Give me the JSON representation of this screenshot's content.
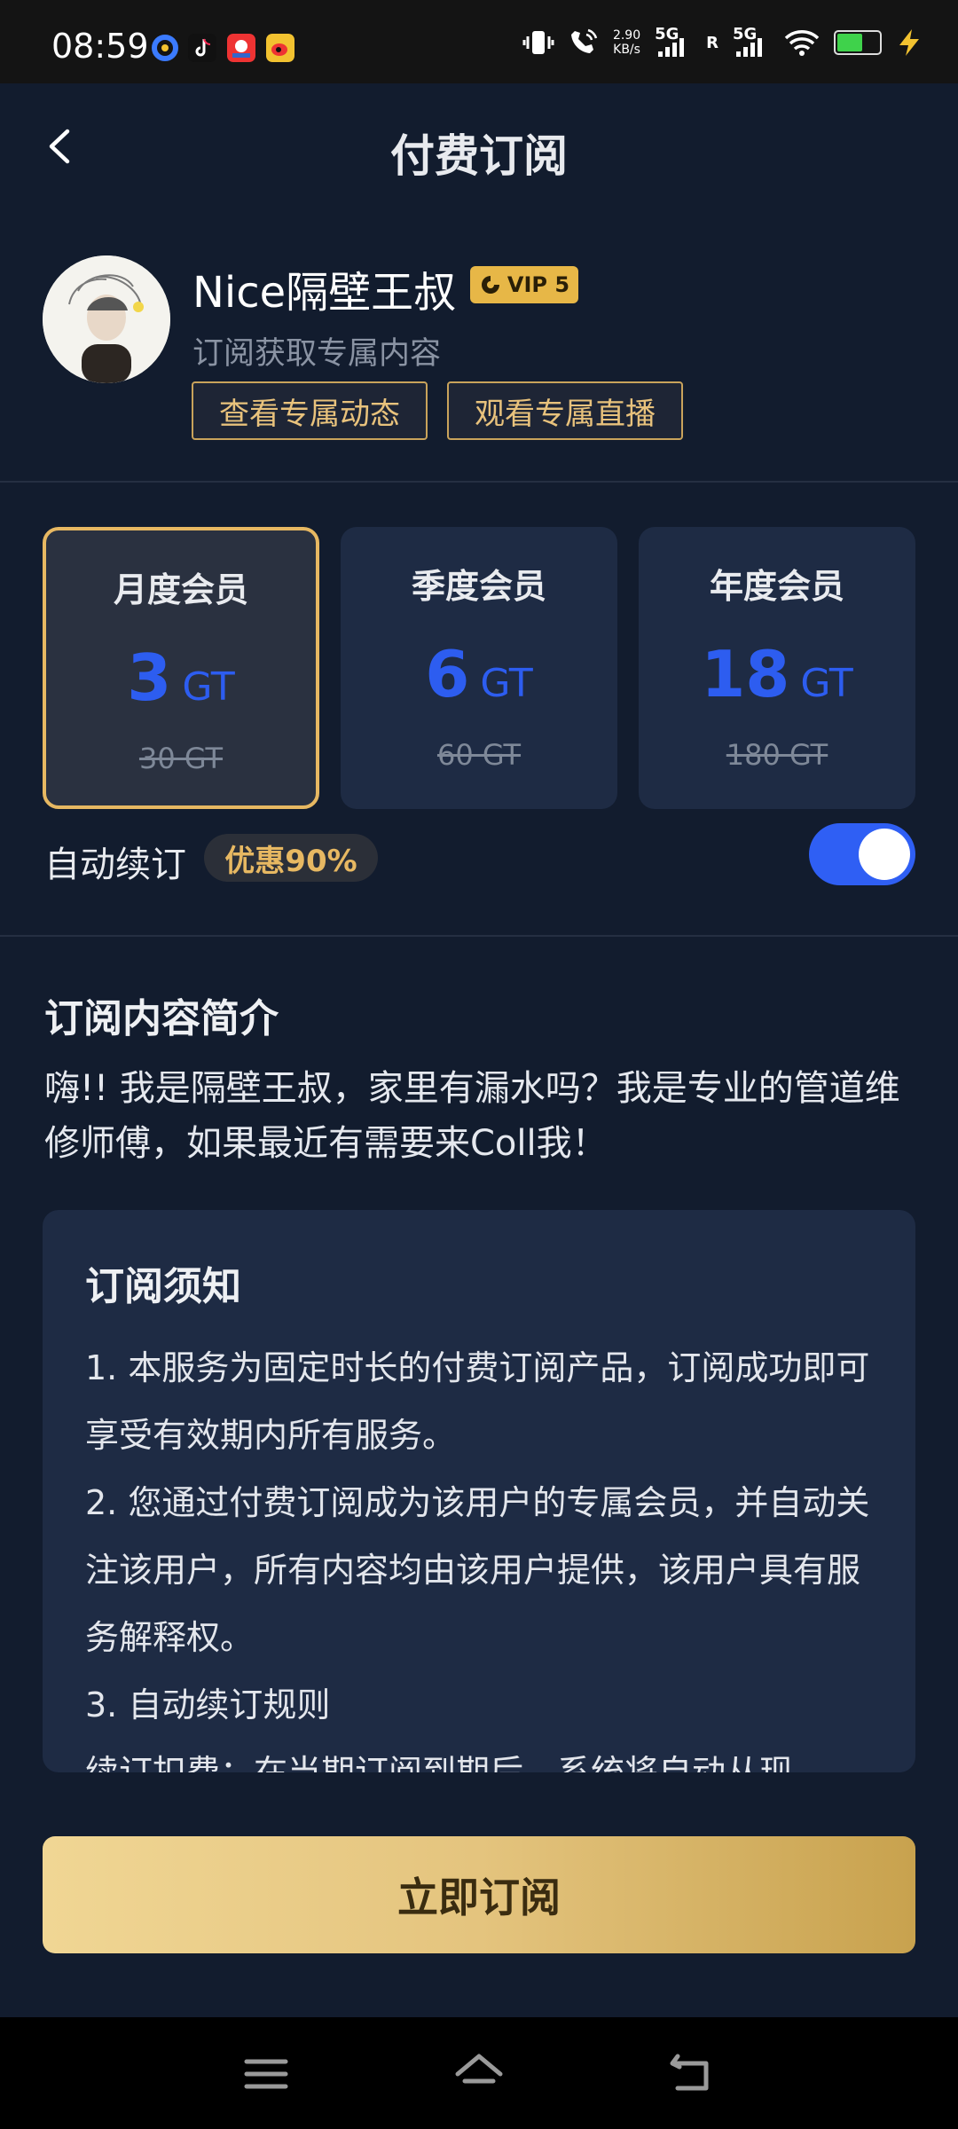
{
  "status_bar": {
    "time": "08:59",
    "net_speed_value": "2.90",
    "net_speed_unit": "KB/s",
    "sim1": "5G",
    "sim2": "5G",
    "roaming": "R"
  },
  "header": {
    "title": "付费订阅",
    "back_icon": "chevron-left-icon"
  },
  "profile": {
    "name": "Nice隔壁王叔",
    "vip_badge": "VIP 5",
    "subtitle": "订阅获取专属内容",
    "btn_posts": "查看专属动态",
    "btn_live": "观看专属直播"
  },
  "plans": [
    {
      "name": "月度会员",
      "price": "3",
      "unit": "GT",
      "original": "30 GT",
      "selected": true
    },
    {
      "name": "季度会员",
      "price": "6",
      "unit": "GT",
      "original": "60 GT",
      "selected": false
    },
    {
      "name": "年度会员",
      "price": "18",
      "unit": "GT",
      "original": "180 GT",
      "selected": false
    }
  ],
  "auto_renew": {
    "label": "自动续订",
    "discount": "优惠90%",
    "enabled": true
  },
  "intro": {
    "title": "订阅内容简介",
    "text": "嗨!! 我是隔壁王叔，家里有漏水吗？我是专业的管道维修师傅，如果最近有需要来Coll我！"
  },
  "notice": {
    "title": "订阅须知",
    "items": [
      "1. 本服务为固定时长的付费订阅产品，订阅成功即可享受有效期内所有服务。",
      "2. 您通过付费订阅成为该用户的专属会员，并自动关注该用户，所有内容均由该用户提供，该用户具有服务解释权。",
      "3. 自动续订规则",
      "续订扣费：在当期订阅到期后，系统将自动从现"
    ]
  },
  "cta": {
    "label": "立即订阅"
  },
  "colors": {
    "background": "#121c2e",
    "card": "#1e2b44",
    "accent_gold": "#e7b862",
    "price_blue": "#2d5df0",
    "toggle_on": "#2f5ff4"
  },
  "nav_bar": {
    "icons": [
      "menu-icon",
      "home-icon",
      "back-icon"
    ]
  }
}
